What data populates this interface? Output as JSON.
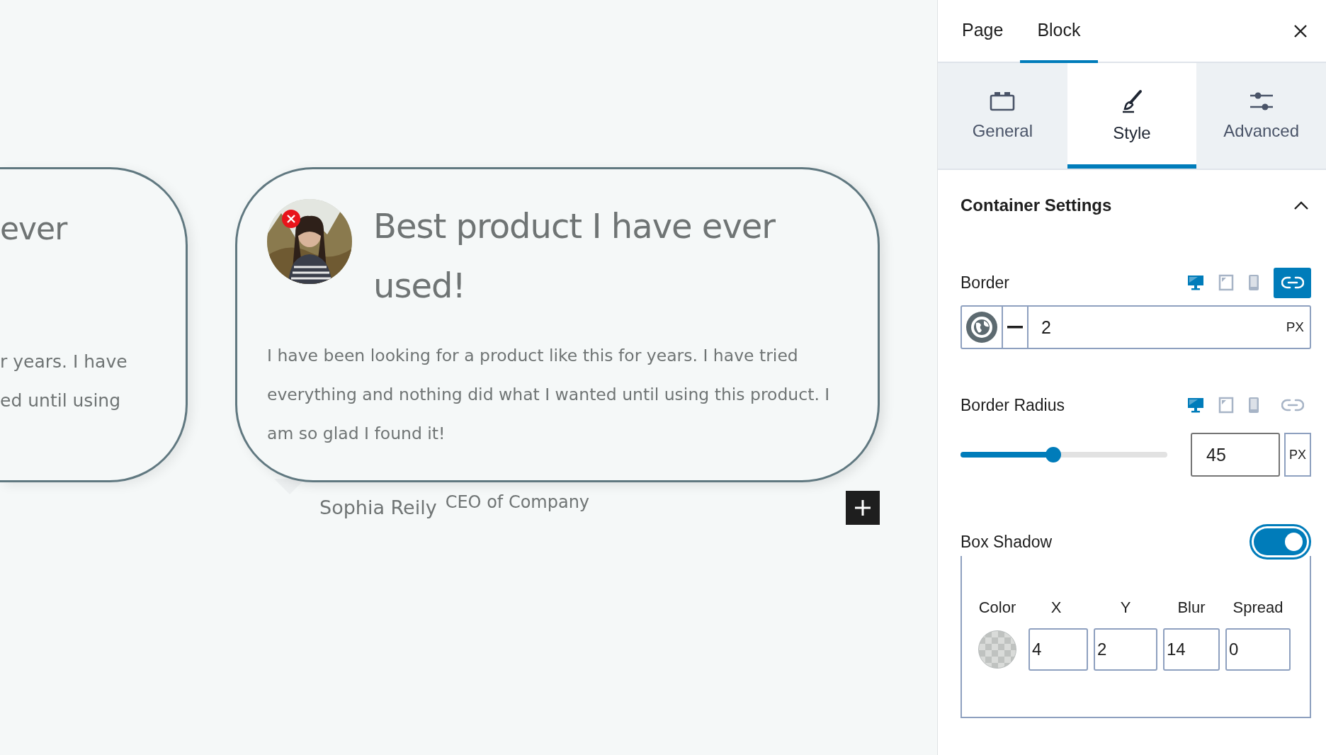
{
  "canvas": {
    "partial_card": {
      "title": "ever",
      "body_lines": [
        "r years. I have",
        "ed until using"
      ]
    },
    "testimonial": {
      "title": "Best product I have ever used!",
      "body": "I have been looking for a product like this for years. I have tried everything and nothing did what I wanted until using this product. I am so glad I found it!",
      "author": "Sophia Reily",
      "role": "CEO of Company"
    }
  },
  "sidebar": {
    "tabs": [
      {
        "label": "Page",
        "selected": false
      },
      {
        "label": "Block",
        "selected": true
      }
    ],
    "subtabs": [
      {
        "label": "General",
        "selected": false
      },
      {
        "label": "Style",
        "selected": true
      },
      {
        "label": "Advanced",
        "selected": false
      }
    ],
    "panel": {
      "title": "Container Settings",
      "expanded": true,
      "border": {
        "label": "Border",
        "devices": [
          {
            "selected": true
          },
          {
            "selected": false
          },
          {
            "selected": false
          }
        ],
        "linked": true,
        "value": "2",
        "unit": "PX"
      },
      "border_radius": {
        "label": "Border Radius",
        "devices": [
          {
            "selected": true
          },
          {
            "selected": false
          },
          {
            "selected": false
          }
        ],
        "linked": false,
        "level": 0.45,
        "value": "45",
        "unit": "PX"
      },
      "box_shadow": {
        "label": "Box Shadow",
        "on": true,
        "columns": [
          "Color",
          "X",
          "Y",
          "Blur",
          "Spread"
        ],
        "values": [
          "4",
          "2",
          "14",
          "0"
        ]
      }
    }
  }
}
